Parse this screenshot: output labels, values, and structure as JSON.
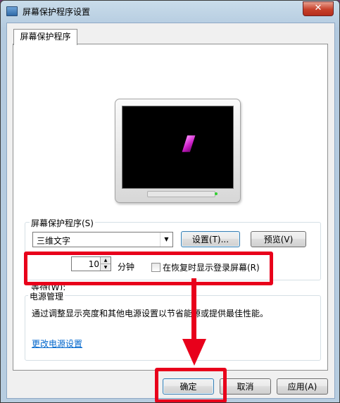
{
  "window": {
    "title": "屏幕保护程序设置",
    "close_label": "✕"
  },
  "tab": {
    "label": "屏幕保护程序"
  },
  "screensaver": {
    "group_label": "屏幕保护程序(S)",
    "selected": "三维文字",
    "settings_button": "设置(T)...",
    "preview_button": "预览(V)",
    "wait_label": "等待(W):",
    "wait_value": "10",
    "wait_unit": "分钟",
    "resume_checkbox_label": "在恢复时显示登录屏幕(R)",
    "resume_checked": false
  },
  "power": {
    "group_label": "电源管理",
    "description": "通过调整显示亮度和其他电源设置以节省能源或提供最佳性能。",
    "link": "更改电源设置"
  },
  "footer": {
    "ok": "确定",
    "cancel": "取消",
    "apply": "应用(A)"
  },
  "colors": {
    "annotation": "#e8001b",
    "link": "#0066cc"
  }
}
